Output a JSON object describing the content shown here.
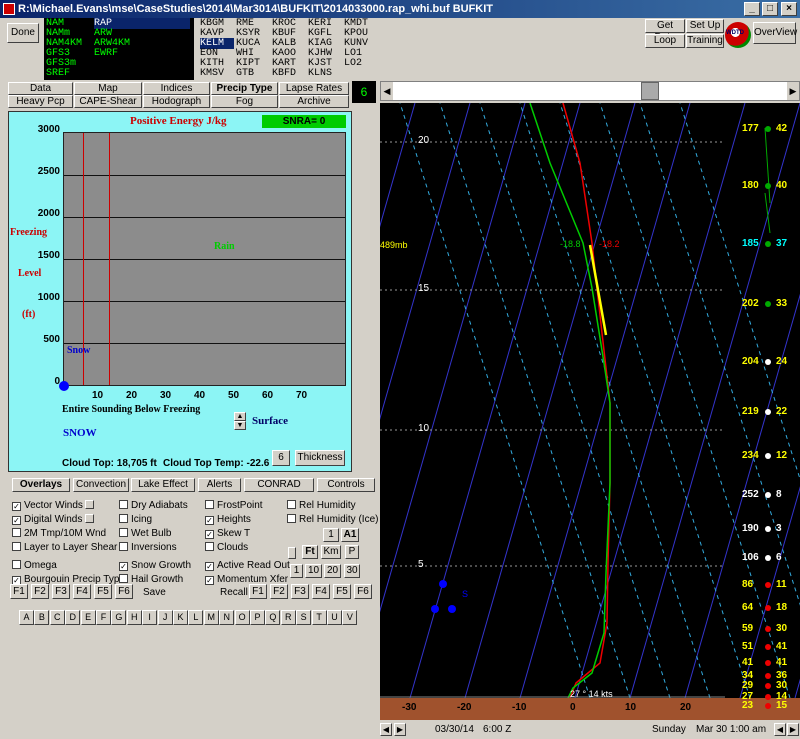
{
  "title": "R:\\Michael.Evans\\mse\\CaseStudies\\2014\\Mar3014\\BUFKIT\\2014033000.rap_whi.buf BUFKIT",
  "window_buttons": [
    "_",
    "□",
    "×"
  ],
  "done_label": "Done",
  "models": [
    "NAM",
    "NAMm",
    "NAM4KM",
    "GFS3",
    "GFS3m",
    "SREF",
    "RAP",
    "ARW",
    "ARW4KM",
    "EWRF"
  ],
  "stations": [
    [
      "KBGM",
      "RME",
      "KROC",
      "KERI",
      "KMDT"
    ],
    [
      "KAVP",
      "KSYR",
      "KBUF",
      "KGFL",
      "KPOU"
    ],
    [
      "KELM",
      "KUCA",
      "KALB",
      "KIAG",
      "KUNV"
    ],
    [
      "EON",
      "WHI",
      "KAOO",
      "KJHW",
      "LO1"
    ],
    [
      "KITH",
      "KIPT",
      "KART",
      "KJST",
      "LO2"
    ],
    [
      "KMSV",
      "GTB",
      "KBFD",
      "KLNS",
      ""
    ]
  ],
  "top_right": {
    "get_data": "Get Data",
    "setup": "Set Up",
    "loop": "Loop",
    "training": "Training",
    "overview": "OverView",
    "logo": "WDTD"
  },
  "tabs_row1": [
    "Data",
    "Map",
    "Indices",
    "Precip Type",
    "Lapse Rates"
  ],
  "tabs_row2": [
    "Heavy Pcp",
    "CAPE-Shear",
    "Hodograph",
    "Fog",
    "Archive"
  ],
  "frame_number": "6",
  "precip": {
    "title": "Positive Energy J/kg",
    "snra": "SNRA= 0",
    "ylabels": [
      "Freezing",
      "Level",
      "(ft)"
    ],
    "yticks": [
      "3000",
      "2500",
      "2000",
      "1500",
      "1000",
      "500",
      "0"
    ],
    "xticks": [
      "10",
      "20",
      "30",
      "40",
      "50",
      "60",
      "70"
    ],
    "rain": "Rain",
    "snow_label": "Snow",
    "sounding": "Entire Sounding Below Freezing",
    "result": "SNOW",
    "surface": "Surface",
    "cloud_top": "Cloud Top: 18,705 ft",
    "cloud_top_temp": "Cloud Top Temp: -22.6",
    "level_btn": "6",
    "thickness_btn": "Thickness"
  },
  "lower_tabs": [
    "Overlays",
    "Convection",
    "Lake Effect",
    "Alerts",
    "CONRAD",
    "Controls"
  ],
  "overlays": {
    "col1": [
      [
        "Vector Winds",
        true
      ],
      [
        "Digital Winds",
        true
      ],
      [
        "2M Tmp/10M Wnd",
        false
      ],
      [
        "Layer to Layer Shear",
        false
      ],
      [
        "Omega",
        false
      ],
      [
        "Bourgouin Precip Type",
        true
      ]
    ],
    "col2": [
      [
        "Dry Adiabats",
        false
      ],
      [
        "Icing",
        false
      ],
      [
        "Wet Bulb",
        false
      ],
      [
        "Inversions",
        false
      ],
      [
        "Snow Growth",
        true
      ],
      [
        "Hail Growth",
        false
      ]
    ],
    "col3": [
      [
        "FrostPoint",
        false
      ],
      [
        "Heights",
        true
      ],
      [
        "Skew T",
        true
      ],
      [
        "Clouds",
        false
      ],
      [
        "Active Read Out",
        true
      ],
      [
        "Momentum Xfer",
        true
      ]
    ],
    "col4": [
      [
        "Rel Humidity",
        false
      ],
      [
        "Rel Humidity (Ice)",
        false
      ]
    ],
    "btn_1": "1",
    "btn_a1": "A1",
    "btn_ft": "Ft",
    "btn_km": "Km",
    "btn_p": "P",
    "levels": [
      "1",
      "10",
      "20",
      "30"
    ]
  },
  "fkeys": [
    "F1",
    "F2",
    "F3",
    "F4",
    "F5",
    "F6"
  ],
  "save": "Save",
  "recall": "Recall",
  "letters": [
    "A",
    "B",
    "C",
    "D",
    "E",
    "F",
    "G",
    "H",
    "I",
    "J",
    "K",
    "L",
    "M",
    "N",
    "O",
    "P",
    "Q",
    "R",
    "S",
    "T",
    "U",
    "V"
  ],
  "skewt": {
    "heights": [
      "20",
      "15",
      "10",
      "5"
    ],
    "pressure_readout": "489mb",
    "temp_readout": "-18.2",
    "dew_readout": "-18.8",
    "sfc_wind": "27 ° 14 kts",
    "xticks": [
      "-30",
      "-20",
      "-10",
      "0",
      "10",
      "20"
    ],
    "winds": [
      [
        "177",
        "42"
      ],
      [
        "180",
        "40"
      ],
      [
        "185",
        "37"
      ],
      [
        "202",
        "33"
      ],
      [
        "204",
        "24"
      ],
      [
        "219",
        "22"
      ],
      [
        "234",
        "12"
      ],
      [
        "252",
        "8"
      ],
      [
        "190",
        "3"
      ],
      [
        "106",
        "6"
      ],
      [
        "86",
        "11"
      ],
      [
        "64",
        "18"
      ],
      [
        "59",
        "30"
      ],
      [
        "51",
        "41"
      ],
      [
        "41",
        "41"
      ],
      [
        "34",
        "36"
      ],
      [
        "29",
        "30"
      ],
      [
        "27",
        "14"
      ],
      [
        "23",
        "15"
      ]
    ],
    "snow_marker": "S"
  },
  "status": {
    "date": "03/30/14",
    "time": "6:00 Z",
    "day": "Sunday",
    "local": "Mar 30  1:00 am"
  }
}
